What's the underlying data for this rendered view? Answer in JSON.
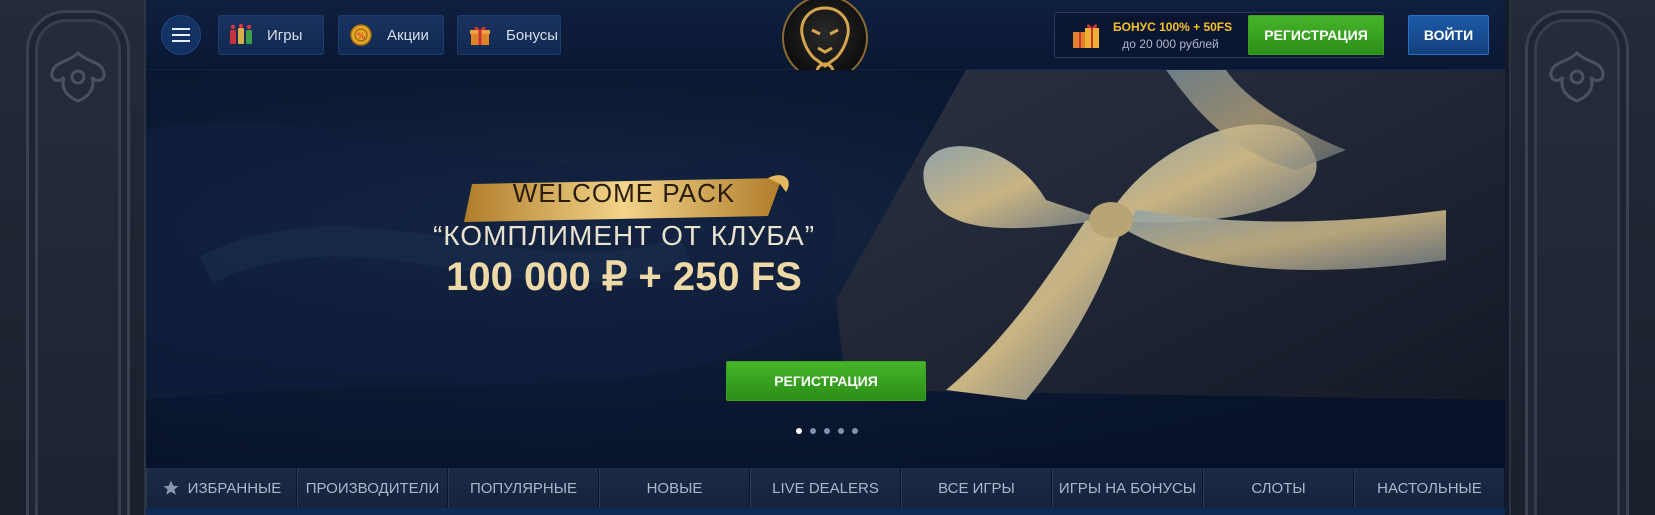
{
  "header": {
    "menu_icon": "hamburger-menu-icon",
    "nav": [
      {
        "label": "Игры",
        "icon": "slot-machines-icon"
      },
      {
        "label": "Акции",
        "icon": "coin-icon"
      },
      {
        "label": "Бонусы",
        "icon": "gift-box-icon"
      }
    ],
    "logo_icon": "lion-head-logo",
    "promo": {
      "line1": "БОНУС 100% + 50FS",
      "line2": "до 20 000 рублей",
      "icon": "gift-boxes-icon"
    },
    "register_label": "РЕГИСТРАЦИЯ",
    "login_label": "ВОЙТИ"
  },
  "banner": {
    "ribbon_text": "WELCOME PACK",
    "headline": "“КОМПЛИМЕНТ ОТ КЛУБА”",
    "amount": "100 000 ₽ + 250 FS",
    "register_label": "РЕГИСТРАЦИЯ",
    "slides_count": 5,
    "active_slide": 1
  },
  "tabs": [
    {
      "label": "ИЗБРАННЫЕ",
      "icon": "star-icon"
    },
    {
      "label": "ПРОИЗВОДИТЕЛИ"
    },
    {
      "label": "ПОПУЛЯРНЫЕ"
    },
    {
      "label": "НОВЫЕ"
    },
    {
      "label": "LIVE DEALERS"
    },
    {
      "label": "ВСЕ ИГРЫ"
    },
    {
      "label": "ИГРЫ НА БОНУСЫ"
    },
    {
      "label": "СЛОТЫ"
    },
    {
      "label": "НАСТОЛЬНЫЕ"
    }
  ],
  "colors": {
    "accent_green": "#3aa31f",
    "login_blue": "#1b5aa8",
    "promo_gold": "#f5c12b",
    "background": "#0b1730"
  }
}
